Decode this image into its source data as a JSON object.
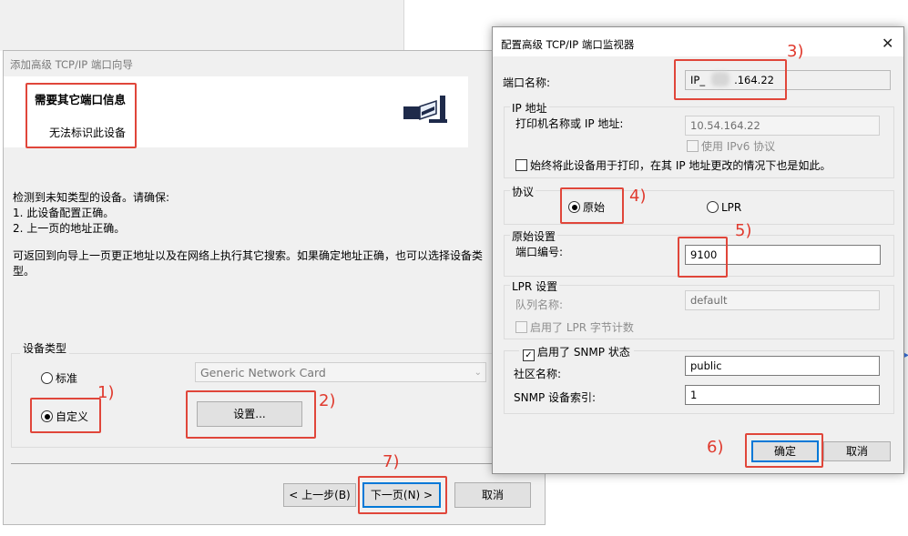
{
  "wizard": {
    "title": "添加高级 TCP/IP 端口向导",
    "header_title": "需要其它端口信息",
    "header_subtitle": "无法标识此设备",
    "body_line1": "检测到未知类型的设备。请确保:",
    "body_line2": "1. 此设备配置正确。",
    "body_line3": "2. 上一页的地址正确。",
    "body_para_line1": "可返回到向导上一页更正地址以及在网络上执行其它搜索。如果确定地址正确，也可以选择设备类",
    "body_para_line2": "型。",
    "device_type_label": "设备类型",
    "radio_standard": "标准",
    "radio_custom": "自定义",
    "standard_combo_value": "Generic Network Card",
    "settings_button": "设置...",
    "back_button": "< 上一步(B)",
    "next_button": "下一页(N) >",
    "cancel_button": "取消"
  },
  "dialog": {
    "title": "配置高级 TCP/IP 端口监视器",
    "close_glyph": "✕",
    "port_name_label": "端口名称:",
    "port_name_value_prefix": "IP_",
    "port_name_value_suffix": ".164.22",
    "ip_group_label": "IP 地址",
    "printer_name_label": "打印机名称或 IP 地址:",
    "printer_name_value": "10.54.164.22",
    "use_ipv6_label": "使用 IPv6 协议",
    "always_use_label": "始终将此设备用于打印，在其 IP 地址更改的情况下也是如此。",
    "protocol_group_label": "协议",
    "protocol_raw": "原始",
    "protocol_lpr": "LPR",
    "raw_settings_label": "原始设置",
    "port_number_label": "端口编号:",
    "port_number_value": "9100",
    "lpr_settings_label": "LPR 设置",
    "queue_name_label": "队列名称:",
    "queue_name_value": "default",
    "lpr_byte_count_label": "启用了 LPR 字节计数",
    "snmp_enabled_label": "启用了 SNMP 状态",
    "community_name_label": "社区名称:",
    "community_name_value": "public",
    "snmp_index_label": "SNMP 设备索引:",
    "snmp_index_value": "1",
    "ok_button": "确定",
    "cancel_button": "取消"
  },
  "annotations": {
    "step1": "1)",
    "step2": "2)",
    "step3": "3)",
    "step4": "4)",
    "step5": "5)",
    "step6": "6)",
    "step7": "7)"
  },
  "colors": {
    "annotation_red": "#e0463a",
    "window_bg": "#f0f0f0",
    "focus_blue": "#0078d7"
  }
}
